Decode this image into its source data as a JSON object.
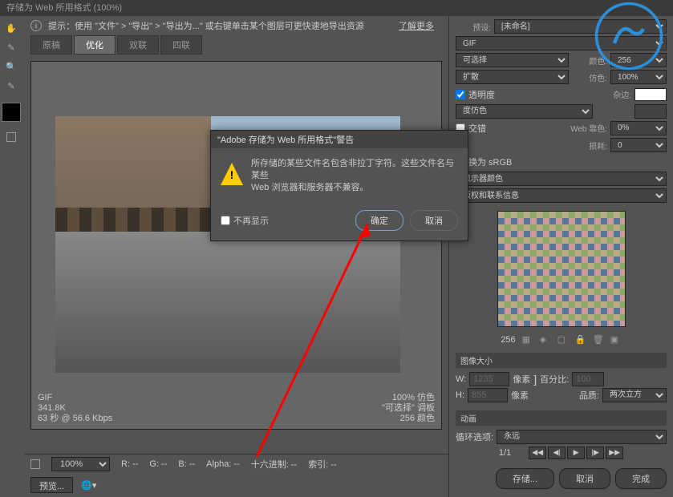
{
  "window_title": "存储为 Web 所用格式 (100%)",
  "hint": {
    "text": "提示：使用 \"文件\" > \"导出\" > \"导出为...\"  或右键单击某个图层可更快速地导出资源",
    "learn_more": "了解更多"
  },
  "tabs": {
    "original": "原稿",
    "optimized": "优化",
    "two_up": "双联",
    "four_up": "四联"
  },
  "stats": {
    "format": "GIF",
    "size": "341.8K",
    "speed": "63 秒 @ 56.6 Kbps",
    "quality": "100% 仿色",
    "palette": "\"可选择\"  调板",
    "colors": "256 颜色"
  },
  "zoom_row": {
    "zoom": "100%",
    "r": "R: --",
    "g": "G: --",
    "b": "B: --",
    "alpha": "Alpha: --",
    "hex": "十六进制: --",
    "index": "索引: --"
  },
  "bottom": {
    "preview": "预览..."
  },
  "right": {
    "preset_lbl": "预设:",
    "preset_val": "[未命名]",
    "format": "GIF",
    "palette_sel": "可选择",
    "color_lbl": "颜色:",
    "color_val": "256",
    "dither": "扩散",
    "dither_lbl": "仿色:",
    "dither_val": "100%",
    "transparency": "透明度",
    "matte_lbl": "杂边:",
    "trans_dither": "度仿色",
    "interlace": "交错",
    "web_lbl": "Web 靠色:",
    "web_val": "0%",
    "lossy_lbl": "损耗:",
    "lossy_val": "0",
    "convert": "换为 sRGB",
    "preview_color": "显示器颜色",
    "metadata": "版权和联系信息",
    "palette_count": "256",
    "size_head": "图像大小",
    "w_lbl": "W:",
    "w_val": "1235",
    "h_lbl": "H:",
    "h_val": "855",
    "px": "像素",
    "pct_lbl": "百分比:",
    "pct_val": "100",
    "quality_lbl": "品质:",
    "quality_val": "两次立方",
    "anim_head": "动画",
    "loop_lbl": "循环选项:",
    "loop_val": "永远",
    "frame": "1/1",
    "save": "存储...",
    "cancel_btn": "取消",
    "done": "完成"
  },
  "dialog": {
    "title": "\"Adobe 存储为 Web 所用格式\"警告",
    "msg1": "所存储的某些文件名包含非拉丁字符。这些文件名与某些",
    "msg2": "Web 浏览器和服务器不兼容。",
    "noshow": "不再显示",
    "ok": "确定",
    "cancel": "取消"
  }
}
